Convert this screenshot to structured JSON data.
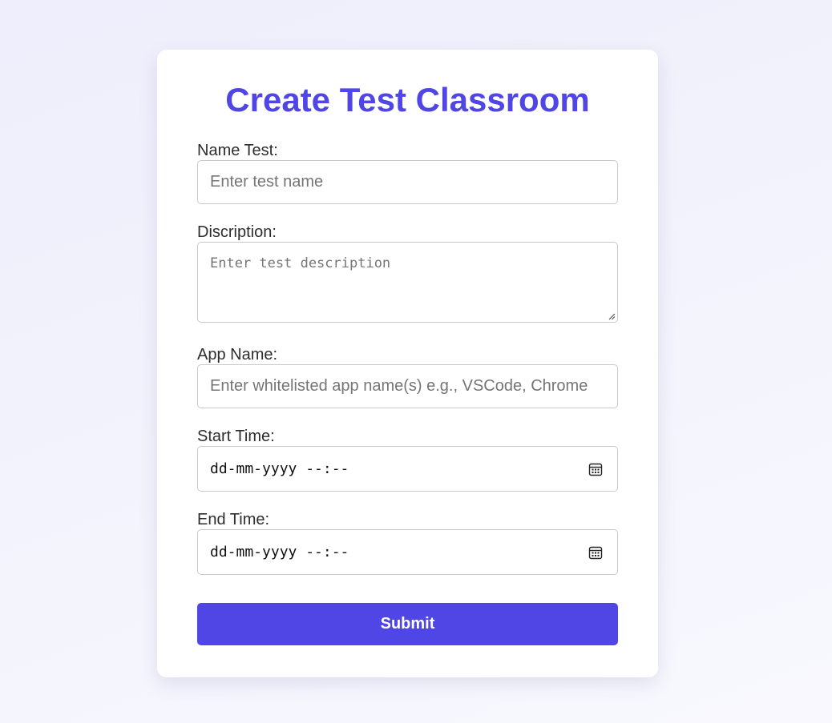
{
  "form": {
    "title": "Create Test Classroom",
    "name_test": {
      "label": "Name Test:",
      "placeholder": "Enter test name"
    },
    "description": {
      "label": "Discription:",
      "placeholder": "Enter test description"
    },
    "app_name": {
      "label": "App Name:",
      "placeholder": "Enter whitelisted app name(s) e.g., VSCode, Chrome"
    },
    "start_time": {
      "label": "Start Time:",
      "value": "dd-mm-yyyy --:--",
      "icon": "calendar-icon"
    },
    "end_time": {
      "label": "End Time:",
      "value": "dd-mm-yyyy --:--",
      "icon": "calendar-icon"
    },
    "submit_label": "Submit"
  },
  "colors": {
    "accent": "#4f46e5",
    "background": "#f1f0fc",
    "card": "#ffffff",
    "border": "#c9c9c9"
  }
}
